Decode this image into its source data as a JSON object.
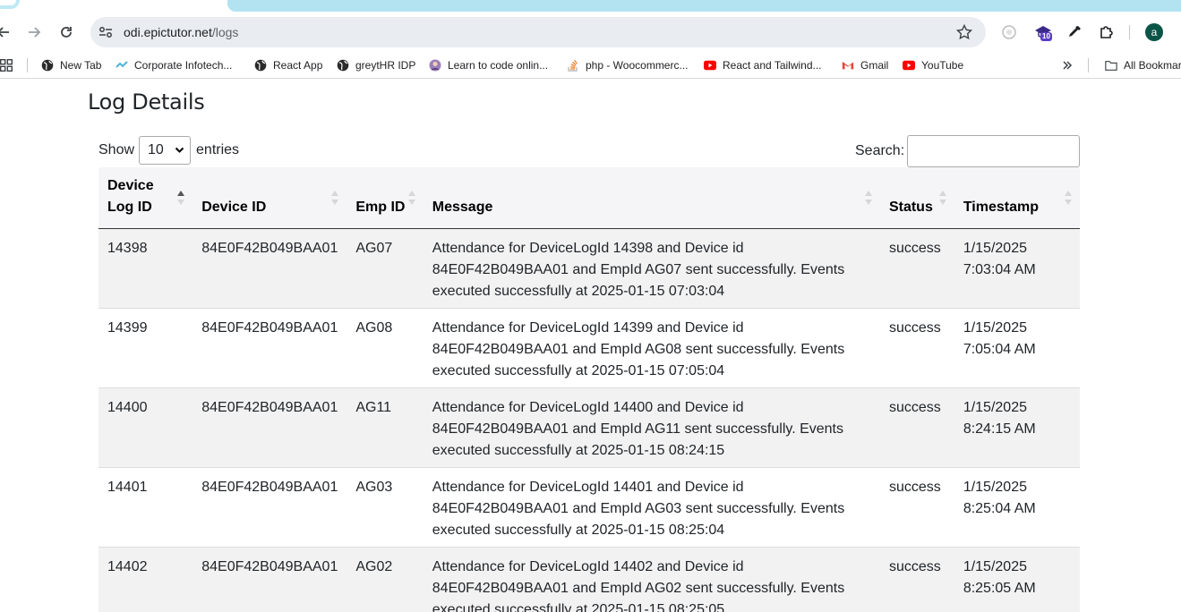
{
  "browser": {
    "url_host": "odi.epictutor.net",
    "url_path": "/logs",
    "extension_badge": "10",
    "profile_initial": "a"
  },
  "bookmarks": [
    {
      "label": "New Tab",
      "icon": "globe-icon"
    },
    {
      "label": "Corporate Infotech...",
      "icon": "corporate-icon"
    },
    {
      "label": "React App",
      "icon": "globe-icon"
    },
    {
      "label": "greytHR IDP",
      "icon": "globe-icon"
    },
    {
      "label": "Learn to code onlin...",
      "icon": "avatar-icon"
    },
    {
      "label": "php - Woocommerc...",
      "icon": "stackoverflow-icon"
    },
    {
      "label": "React and Tailwind...",
      "icon": "youtube-icon"
    },
    {
      "label": "Gmail",
      "icon": "gmail-icon"
    },
    {
      "label": "YouTube",
      "icon": "youtube-icon"
    }
  ],
  "bookmarks_all": "All Bookmar",
  "page": {
    "title": "Log Details",
    "show_label": "Show",
    "entries_label": "entries",
    "page_length": "10",
    "search_label": "Search:",
    "search_value": ""
  },
  "table": {
    "headers": {
      "device_log_id": "Device Log ID",
      "device_id": "Device ID",
      "emp_id": "Emp ID",
      "message": "Message",
      "status": "Status",
      "timestamp": "Timestamp"
    },
    "rows": [
      {
        "device_log_id": "14398",
        "device_id": "84E0F42B049BAA01",
        "emp_id": "AG07",
        "message": "Attendance for DeviceLogId 14398 and Device id 84E0F42B049BAA01 and EmpId AG07 sent successfully. Events executed successfully at 2025-01-15 07:03:04",
        "status": "success",
        "date": "1/15/2025",
        "time": "7:03:04 AM"
      },
      {
        "device_log_id": "14399",
        "device_id": "84E0F42B049BAA01",
        "emp_id": "AG08",
        "message": "Attendance for DeviceLogId 14399 and Device id 84E0F42B049BAA01 and EmpId AG08 sent successfully. Events executed successfully at 2025-01-15 07:05:04",
        "status": "success",
        "date": "1/15/2025",
        "time": "7:05:04 AM"
      },
      {
        "device_log_id": "14400",
        "device_id": "84E0F42B049BAA01",
        "emp_id": "AG11",
        "message": "Attendance for DeviceLogId 14400 and Device id 84E0F42B049BAA01 and EmpId AG11 sent successfully. Events executed successfully at 2025-01-15 08:24:15",
        "status": "success",
        "date": "1/15/2025",
        "time": "8:24:15 AM"
      },
      {
        "device_log_id": "14401",
        "device_id": "84E0F42B049BAA01",
        "emp_id": "AG03",
        "message": "Attendance for DeviceLogId 14401 and Device id 84E0F42B049BAA01 and EmpId AG03 sent successfully. Events executed successfully at 2025-01-15 08:25:04",
        "status": "success",
        "date": "1/15/2025",
        "time": "8:25:04 AM"
      },
      {
        "device_log_id": "14402",
        "device_id": "84E0F42B049BAA01",
        "emp_id": "AG02",
        "message": "Attendance for DeviceLogId 14402 and Device id 84E0F42B049BAA01 and EmpId AG02 sent successfully. Events executed successfully at 2025-01-15 08:25:05",
        "status": "success",
        "date": "1/15/2025",
        "time": "8:25:05 AM"
      }
    ]
  },
  "colors": {
    "row_stripe": "#f2f2f2",
    "header_bg": "#f5f5f7",
    "profile_bg": "#0b5547"
  }
}
